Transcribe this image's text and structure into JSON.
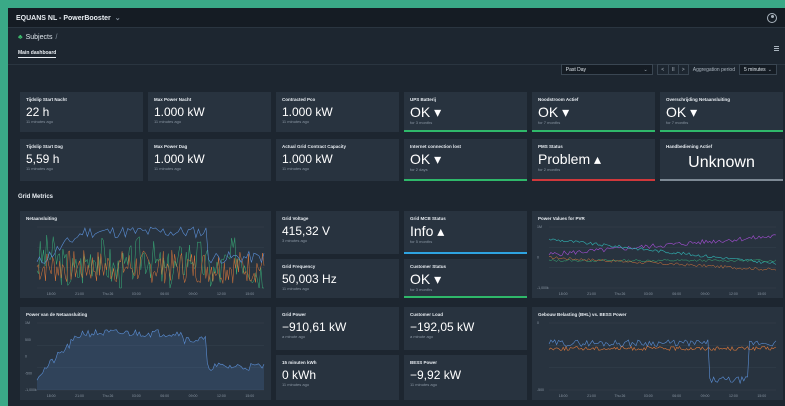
{
  "header": {
    "app_title": "EQUANS NL - PowerBooster",
    "caret": "⌄"
  },
  "breadcrumb": {
    "root": "Subjects",
    "sep": "/"
  },
  "tabs": {
    "active": "Main dashboard"
  },
  "controls": {
    "range_value": "Past Day",
    "pager_prev": "<",
    "pager_pause": "II",
    "pager_next": ">",
    "aggregation_label": "Aggregation period",
    "aggregation_value": "5 minutes"
  },
  "section": {
    "grid_metrics": "Grid Metrics"
  },
  "colors": {
    "ok": "#2fb86a",
    "problem": "#d0383b",
    "unknown": "#7d8994",
    "info": "#2ea3e0",
    "card_bg": "#28333f",
    "chart_blue": "#5b8fd6",
    "chart_orange": "#e07a3a",
    "chart_green": "#3ab27a",
    "chart_purple": "#a64fd6",
    "chart_teal": "#31b5b5"
  },
  "cards": {
    "tijdslip_nacht": {
      "title": "Tijdslip Start Nacht",
      "value": "22 h",
      "sub": "11 minutes ago"
    },
    "max_power_nacht": {
      "title": "Max Power Nacht",
      "value": "1.000 kW",
      "sub": "11 minutes ago"
    },
    "contracted_pco": {
      "title": "Contracted Pco",
      "value": "1.000 kW",
      "sub": "11 minutes ago"
    },
    "ups_batterij": {
      "title": "UPS Batterij",
      "value": "OK ▾",
      "sub": "for 3 months"
    },
    "noodstroom": {
      "title": "Noodstroom Actief",
      "value": "OK ▾",
      "sub": "for 7 months"
    },
    "overschrijding": {
      "title": "Overschrijding Netaansluiting",
      "value": "OK ▾",
      "sub": "for 7 months"
    },
    "tijdslip_dag": {
      "title": "Tijdslip Start Dag",
      "value": "5,59 h",
      "sub": "11 minutes ago"
    },
    "max_power_dag": {
      "title": "Max Power Dag",
      "value": "1.000 kW",
      "sub": "11 minutes ago"
    },
    "actual_grid": {
      "title": "Actual Grid Contract Capacity",
      "value": "1.000 kW",
      "sub": "11 minutes ago"
    },
    "internet": {
      "title": "Internet connection lost",
      "value": "OK ▾",
      "sub": "for 2 days"
    },
    "pms_status": {
      "title": "PMS Status",
      "value": "Problem ▴",
      "sub": "for 2 months"
    },
    "handbediening": {
      "title": "Handbediening Actief",
      "value": "Unknown",
      "sub": ""
    },
    "grid_voltage": {
      "title": "Grid Voltage",
      "value": "415,32 V",
      "sub": "3 minutes ago"
    },
    "grid_mcb": {
      "title": "Grid MCB Status",
      "value": "Info ▴",
      "sub": "for 5 months"
    },
    "grid_frequency": {
      "title": "Grid Frequency",
      "value": "50,003 Hz",
      "sub": "11 minutes ago"
    },
    "customer_status": {
      "title": "Customer Status",
      "value": "OK ▾",
      "sub": "for 3 months"
    },
    "grid_power": {
      "title": "Grid Power",
      "value": "−910,61 kW",
      "sub": "a minute ago"
    },
    "customer_load": {
      "title": "Customer Load",
      "value": "−192,05 kW",
      "sub": "a minute ago"
    },
    "kwh15": {
      "title": "15 minuten kWh",
      "value": "0 kWh",
      "sub": "11 minutes ago"
    },
    "bess_power": {
      "title": "BESS Power",
      "value": "−9,92 kW",
      "sub": "11 minutes ago"
    }
  },
  "charts": {
    "netaansluiting": {
      "title": "Netaansluiting",
      "xticks": [
        "18:00",
        "21:00",
        "Thu 26",
        "03:00",
        "06:00",
        "09:00",
        "12:00",
        "15:00"
      ]
    },
    "power_values": {
      "title": "Power Values for PVR",
      "xticks": [
        "18:00",
        "21:00",
        "Thu 26",
        "03:00",
        "06:00",
        "09:00",
        "12:00",
        "15:00"
      ],
      "yticks": [
        "1M",
        "0",
        "-1,000k"
      ]
    },
    "power_van_de_netaansluiting": {
      "title": "Power van de Netaansluiting",
      "xticks": [
        "18:00",
        "21:00",
        "Thu 26",
        "03:00",
        "06:00",
        "09:00",
        "12:00",
        "15:00"
      ],
      "yticks": [
        "1M",
        "500",
        "0",
        "-500",
        "-1,000k"
      ]
    },
    "gebouw_belasting": {
      "title": "Gebouw Belasting (BHL) vs. BESS Power",
      "xticks": [
        "18:00",
        "21:00",
        "Thu 26",
        "03:00",
        "06:00",
        "09:00",
        "12:00",
        "15:00"
      ],
      "yticks": [
        "0",
        "-500"
      ]
    }
  }
}
